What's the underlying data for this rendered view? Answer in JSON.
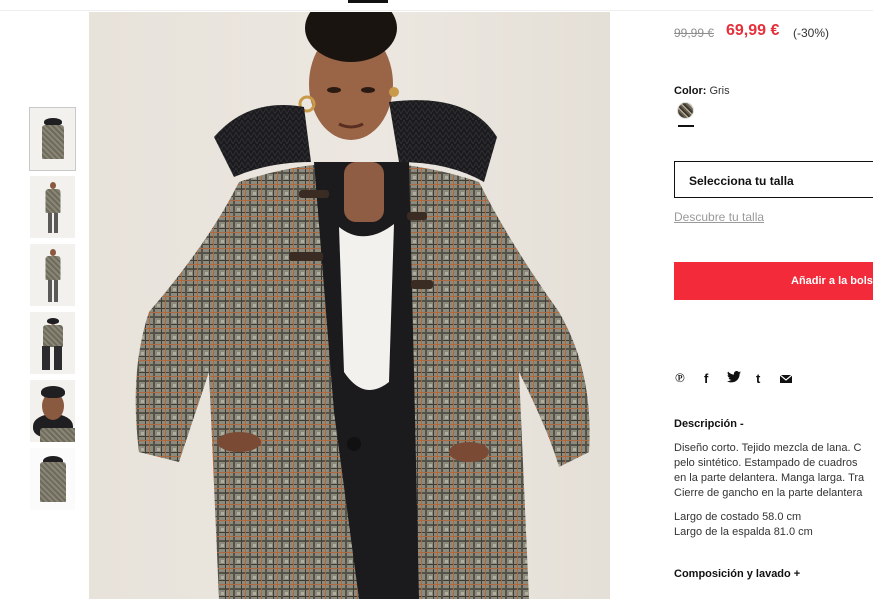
{
  "product": {
    "old_price": "99,99 €",
    "sale_price": "69,99 €",
    "discount": "(-30%)",
    "color_label": "Color:",
    "color_value": "Gris",
    "size_select_label": "Selecciona tu talla",
    "size_guide_link": "Descubre tu talla",
    "add_to_bag_label": "Añadir a la bolsa",
    "share_icons": [
      "pinterest-icon",
      "facebook-icon",
      "twitter-icon",
      "tumblr-icon",
      "email-icon"
    ],
    "description_title": "Descripción -",
    "description_lines": [
      "Diseño corto. Tejido mezcla de lana. C",
      "pelo sintético. Estampado de cuadros",
      "en la parte delantera. Manga larga. Tra",
      "Cierre de gancho en la parte delantera"
    ],
    "measures": [
      "Largo de costado 58.0 cm",
      "Largo de la espalda 81.0 cm"
    ],
    "composition_title": "Composición y lavado +"
  },
  "gallery": {
    "thumbnail_count": 6,
    "selected_index": 0
  },
  "colors": {
    "sale": "#e5303b",
    "button": "#f22a39"
  }
}
